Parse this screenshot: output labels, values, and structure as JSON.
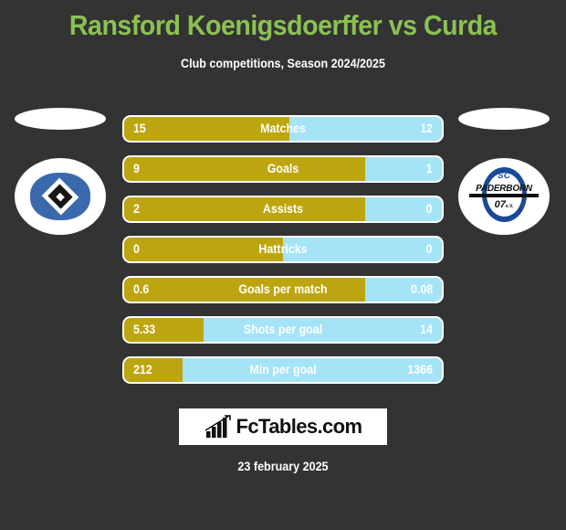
{
  "header": {
    "title": "Ransford Koenigsdoerffer vs Curda",
    "subtitle": "Club competitions, Season 2024/2025",
    "title_color": "#8cc152"
  },
  "teams": {
    "home": {
      "name": "Hamburger SV",
      "logo": "hsv-crest-icon"
    },
    "away": {
      "name": "SC Paderborn 07",
      "logo": "paderborn-crest-icon",
      "crest_top": "SC",
      "crest_name": "PADERBORN",
      "crest_year": "07",
      "crest_suffix": "e.V."
    }
  },
  "colors": {
    "background": "#333333",
    "home_bar": "#bda50f",
    "away_bar": "#a5e3f7",
    "accent_green": "#8cc152"
  },
  "chart_data": {
    "type": "bar",
    "title": "Ransford Koenigsdoerffer vs Curda",
    "subtitle": "Club competitions, Season 2024/2025",
    "orientation": "horizontal-diverging",
    "legend": [
      "Ransford Koenigsdoerffer",
      "Curda"
    ],
    "categories": [
      "Matches",
      "Goals",
      "Assists",
      "Hattricks",
      "Goals per match",
      "Shots per goal",
      "Min per goal"
    ],
    "series": [
      {
        "name": "Ransford Koenigsdoerffer",
        "color": "#bda50f",
        "values": [
          "15",
          "9",
          "2",
          "0",
          "0.6",
          "5.33",
          "212"
        ]
      },
      {
        "name": "Curda",
        "color": "#a5e3f7",
        "values": [
          "12",
          "1",
          "0",
          "0",
          "0.08",
          "14",
          "1366"
        ]
      }
    ],
    "fill_percent": [
      52,
      76,
      76,
      50,
      76,
      25,
      18.4
    ]
  },
  "rows": [
    {
      "label": "Matches",
      "left": "15",
      "right": "12",
      "fill": 52
    },
    {
      "label": "Goals",
      "left": "9",
      "right": "1",
      "fill": 76
    },
    {
      "label": "Assists",
      "left": "2",
      "right": "0",
      "fill": 76
    },
    {
      "label": "Hattricks",
      "left": "0",
      "right": "0",
      "fill": 50
    },
    {
      "label": "Goals per match",
      "left": "0.6",
      "right": "0.08",
      "fill": 76
    },
    {
      "label": "Shots per goal",
      "left": "5.33",
      "right": "14",
      "fill": 25
    },
    {
      "label": "Min per goal",
      "left": "212",
      "right": "1366",
      "fill": 18.4
    }
  ],
  "footer": {
    "brand": "FcTables.com",
    "brand_icon": "bar-chart-icon",
    "date": "23 february 2025"
  }
}
